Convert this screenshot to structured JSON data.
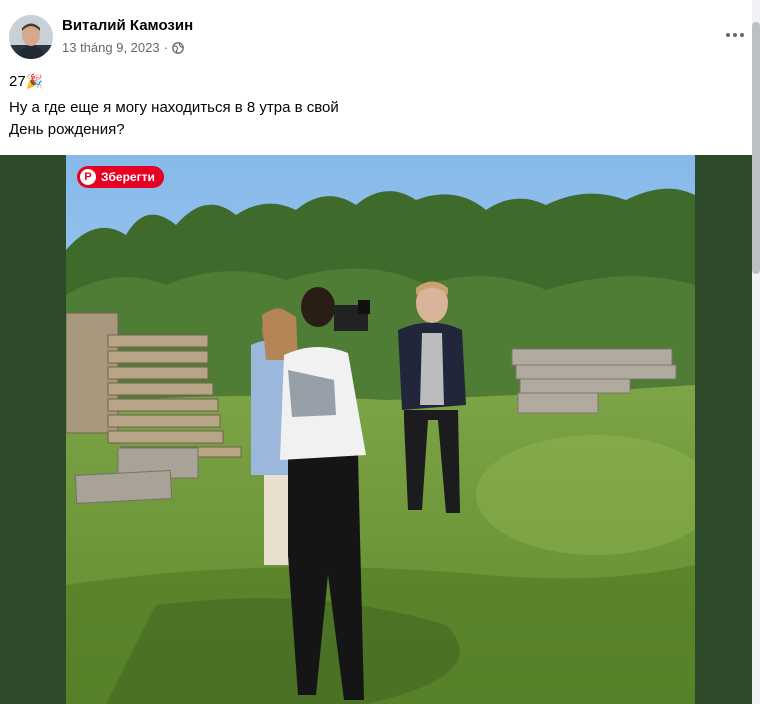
{
  "post": {
    "author": "Виталий Камозин",
    "date": "13 tháng 9, 2023",
    "separator": " · ",
    "audience_icon": "globe-icon",
    "more_icon": "more-options-icon",
    "text_line1": "27",
    "text_emoji": "🎉",
    "text_line2": "Ну а где еще я могу находиться в 8 утра в свой",
    "text_line3": "День рождения?"
  },
  "pinterest": {
    "label": "Зберегти",
    "icon": "pinterest-icon",
    "color": "#e60023"
  },
  "colors": {
    "media_background": "#2e4a2a",
    "sky": "#9cc7ec",
    "grass": "#6f9a3a"
  }
}
